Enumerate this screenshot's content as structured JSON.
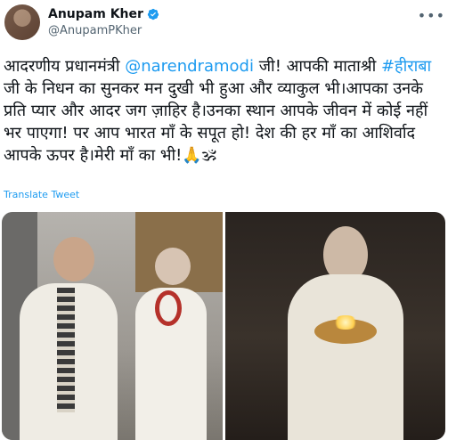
{
  "author": {
    "name": "Anupam Kher",
    "handle": "@AnupamPKher"
  },
  "tweet": {
    "p1": "आदरणीय प्रधानमंत्री ",
    "mention": "@narendramodi",
    "p2": " जी! आपकी माताश्री ",
    "hashtag": "#हीराबा",
    "p3": " जी के निधन का सुनकर मन दुखी भी हुआ और व्याकुल भी।आपका उनके प्रति प्यार और आदर जग ज़ाहिर है।उनका स्थान आपके जीवन में कोई नहीं भर पाएगा! पर आप भारत माँ के सपूत हो! देश की हर माँ का आशिर्वाद आपके ऊपर है।मेरी माँ का भी!🙏🕉"
  },
  "translate_label": "Translate Tweet",
  "colors": {
    "link": "#1d9bf0",
    "text": "#0f1419",
    "muted": "#536471"
  },
  "icons": {
    "verified": "verified-badge-icon",
    "more": "more-options-icon"
  }
}
